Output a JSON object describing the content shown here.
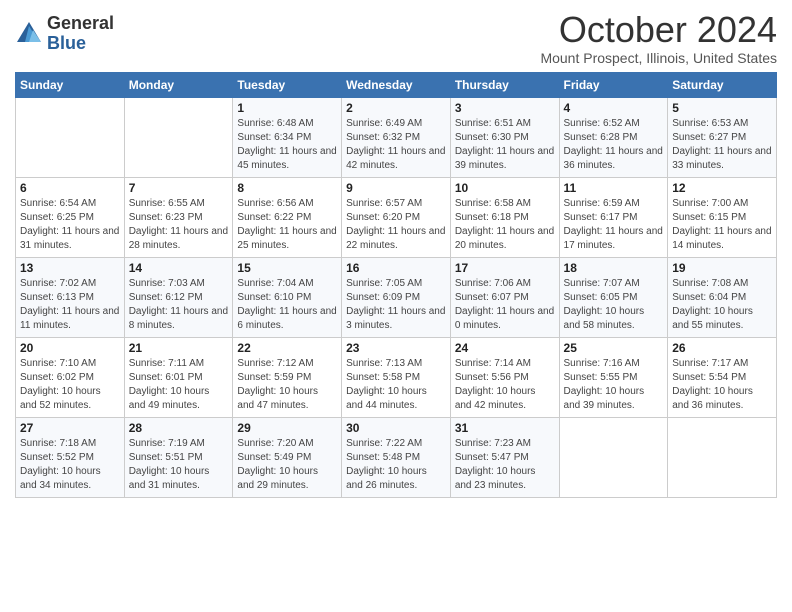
{
  "logo": {
    "general": "General",
    "blue": "Blue"
  },
  "title": "October 2024",
  "subtitle": "Mount Prospect, Illinois, United States",
  "days_of_week": [
    "Sunday",
    "Monday",
    "Tuesday",
    "Wednesday",
    "Thursday",
    "Friday",
    "Saturday"
  ],
  "weeks": [
    [
      {
        "day": "",
        "info": ""
      },
      {
        "day": "",
        "info": ""
      },
      {
        "day": "1",
        "info": "Sunrise: 6:48 AM\nSunset: 6:34 PM\nDaylight: 11 hours and 45 minutes."
      },
      {
        "day": "2",
        "info": "Sunrise: 6:49 AM\nSunset: 6:32 PM\nDaylight: 11 hours and 42 minutes."
      },
      {
        "day": "3",
        "info": "Sunrise: 6:51 AM\nSunset: 6:30 PM\nDaylight: 11 hours and 39 minutes."
      },
      {
        "day": "4",
        "info": "Sunrise: 6:52 AM\nSunset: 6:28 PM\nDaylight: 11 hours and 36 minutes."
      },
      {
        "day": "5",
        "info": "Sunrise: 6:53 AM\nSunset: 6:27 PM\nDaylight: 11 hours and 33 minutes."
      }
    ],
    [
      {
        "day": "6",
        "info": "Sunrise: 6:54 AM\nSunset: 6:25 PM\nDaylight: 11 hours and 31 minutes."
      },
      {
        "day": "7",
        "info": "Sunrise: 6:55 AM\nSunset: 6:23 PM\nDaylight: 11 hours and 28 minutes."
      },
      {
        "day": "8",
        "info": "Sunrise: 6:56 AM\nSunset: 6:22 PM\nDaylight: 11 hours and 25 minutes."
      },
      {
        "day": "9",
        "info": "Sunrise: 6:57 AM\nSunset: 6:20 PM\nDaylight: 11 hours and 22 minutes."
      },
      {
        "day": "10",
        "info": "Sunrise: 6:58 AM\nSunset: 6:18 PM\nDaylight: 11 hours and 20 minutes."
      },
      {
        "day": "11",
        "info": "Sunrise: 6:59 AM\nSunset: 6:17 PM\nDaylight: 11 hours and 17 minutes."
      },
      {
        "day": "12",
        "info": "Sunrise: 7:00 AM\nSunset: 6:15 PM\nDaylight: 11 hours and 14 minutes."
      }
    ],
    [
      {
        "day": "13",
        "info": "Sunrise: 7:02 AM\nSunset: 6:13 PM\nDaylight: 11 hours and 11 minutes."
      },
      {
        "day": "14",
        "info": "Sunrise: 7:03 AM\nSunset: 6:12 PM\nDaylight: 11 hours and 8 minutes."
      },
      {
        "day": "15",
        "info": "Sunrise: 7:04 AM\nSunset: 6:10 PM\nDaylight: 11 hours and 6 minutes."
      },
      {
        "day": "16",
        "info": "Sunrise: 7:05 AM\nSunset: 6:09 PM\nDaylight: 11 hours and 3 minutes."
      },
      {
        "day": "17",
        "info": "Sunrise: 7:06 AM\nSunset: 6:07 PM\nDaylight: 11 hours and 0 minutes."
      },
      {
        "day": "18",
        "info": "Sunrise: 7:07 AM\nSunset: 6:05 PM\nDaylight: 10 hours and 58 minutes."
      },
      {
        "day": "19",
        "info": "Sunrise: 7:08 AM\nSunset: 6:04 PM\nDaylight: 10 hours and 55 minutes."
      }
    ],
    [
      {
        "day": "20",
        "info": "Sunrise: 7:10 AM\nSunset: 6:02 PM\nDaylight: 10 hours and 52 minutes."
      },
      {
        "day": "21",
        "info": "Sunrise: 7:11 AM\nSunset: 6:01 PM\nDaylight: 10 hours and 49 minutes."
      },
      {
        "day": "22",
        "info": "Sunrise: 7:12 AM\nSunset: 5:59 PM\nDaylight: 10 hours and 47 minutes."
      },
      {
        "day": "23",
        "info": "Sunrise: 7:13 AM\nSunset: 5:58 PM\nDaylight: 10 hours and 44 minutes."
      },
      {
        "day": "24",
        "info": "Sunrise: 7:14 AM\nSunset: 5:56 PM\nDaylight: 10 hours and 42 minutes."
      },
      {
        "day": "25",
        "info": "Sunrise: 7:16 AM\nSunset: 5:55 PM\nDaylight: 10 hours and 39 minutes."
      },
      {
        "day": "26",
        "info": "Sunrise: 7:17 AM\nSunset: 5:54 PM\nDaylight: 10 hours and 36 minutes."
      }
    ],
    [
      {
        "day": "27",
        "info": "Sunrise: 7:18 AM\nSunset: 5:52 PM\nDaylight: 10 hours and 34 minutes."
      },
      {
        "day": "28",
        "info": "Sunrise: 7:19 AM\nSunset: 5:51 PM\nDaylight: 10 hours and 31 minutes."
      },
      {
        "day": "29",
        "info": "Sunrise: 7:20 AM\nSunset: 5:49 PM\nDaylight: 10 hours and 29 minutes."
      },
      {
        "day": "30",
        "info": "Sunrise: 7:22 AM\nSunset: 5:48 PM\nDaylight: 10 hours and 26 minutes."
      },
      {
        "day": "31",
        "info": "Sunrise: 7:23 AM\nSunset: 5:47 PM\nDaylight: 10 hours and 23 minutes."
      },
      {
        "day": "",
        "info": ""
      },
      {
        "day": "",
        "info": ""
      }
    ]
  ]
}
